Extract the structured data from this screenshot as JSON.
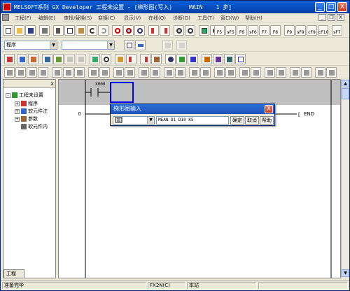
{
  "window": {
    "title": "MELSOFT系列 GX Developer 工程未设置 - [梯形图(写入)     MAIN    1 步]",
    "min_label": "_",
    "max_label": "□",
    "close_label": "X"
  },
  "menubar": {
    "items": [
      "工程(F)",
      "编辑(E)",
      "查找/替换(S)",
      "变换(C)",
      "显示(V)",
      "在线(O)",
      "诊断(D)",
      "工具(T)",
      "窗口(W)",
      "帮助(H)"
    ],
    "mdi_min": "_",
    "mdi_restore": "❐",
    "mdi_close": "X"
  },
  "toolbar_main": {
    "fkeys": [
      "F5",
      "sF5",
      "F6",
      "sF6",
      "F7",
      "F8",
      "F9",
      "sF9",
      "cF9",
      "cF10",
      "sF7"
    ]
  },
  "toolbar_second": {
    "program_combo": "程序",
    "device_combo": ""
  },
  "tree": {
    "close_label": "x",
    "root": "工程未设置",
    "items": [
      {
        "expander": "+",
        "label": "程序"
      },
      {
        "expander": "+",
        "label": "软元件注"
      },
      {
        "expander": "+",
        "label": "参数"
      },
      {
        "expander": "",
        "label": "软元件内"
      }
    ],
    "tab_label": "工程"
  },
  "ladder": {
    "contact_label": "X000",
    "step_number": "0",
    "end_label": "END",
    "end_bracket": "["
  },
  "dialog": {
    "title": "梯形图输入",
    "input_value": "MEAN D1 D10 K5",
    "ok_label": "确定",
    "cancel_label": "取消",
    "help_label": "帮助",
    "close_label": "X"
  },
  "statusbar": {
    "ready": "准备完毕",
    "cpu": "FX2N(C)",
    "station": "本站"
  },
  "colors": {
    "titlebar": "#0a5fd8",
    "rail_band": "#c0c0c0",
    "cursor": "#0000ff"
  }
}
